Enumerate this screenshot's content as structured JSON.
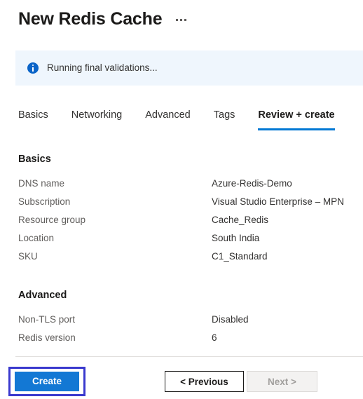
{
  "header": {
    "title": "New Redis Cache",
    "more_label": "...",
    "more_icon": "ellipsis-icon"
  },
  "banner": {
    "icon": "info-icon",
    "message": "Running final validations...",
    "background": "#eff6fd",
    "icon_color": "#0a64c8"
  },
  "tabs": {
    "accent": "#0078d4",
    "items": [
      {
        "label": "Basics",
        "active": false
      },
      {
        "label": "Networking",
        "active": false
      },
      {
        "label": "Advanced",
        "active": false
      },
      {
        "label": "Tags",
        "active": false
      },
      {
        "label": "Review + create",
        "active": true
      }
    ]
  },
  "sections": [
    {
      "heading": "Basics",
      "rows": [
        {
          "key": "DNS name",
          "value": "Azure-Redis-Demo"
        },
        {
          "key": "Subscription",
          "value": "Visual Studio Enterprise – MPN"
        },
        {
          "key": "Resource group",
          "value": "Cache_Redis"
        },
        {
          "key": "Location",
          "value": "South India"
        },
        {
          "key": "SKU",
          "value": "C1_Standard"
        }
      ]
    },
    {
      "heading": "Advanced",
      "rows": [
        {
          "key": "Non-TLS port",
          "value": "Disabled"
        },
        {
          "key": "Redis version",
          "value": "6"
        }
      ]
    }
  ],
  "footer": {
    "create_label": "Create",
    "previous_label": "< Previous",
    "next_label": "Next >",
    "create_color": "#1378d4",
    "highlight_color": "#3a39ce"
  }
}
